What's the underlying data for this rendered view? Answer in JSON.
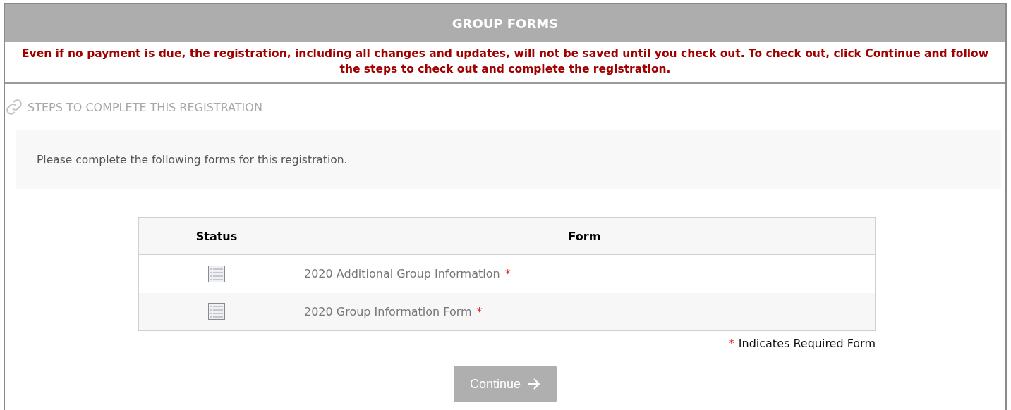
{
  "header": {
    "title": "GROUP FORMS"
  },
  "notice": "Even if no payment is due, the registration, including all changes and updates, will not be saved until you check out. To check out, click Continue and follow the steps to check out and complete the registration.",
  "steps_heading": "STEPS TO COMPLETE THIS REGISTRATION",
  "instructions": "Please complete the following forms for this registration.",
  "table": {
    "columns": [
      "Status",
      "Form"
    ],
    "rows": [
      {
        "form": "2020 Additional Group Information",
        "required_mark": "*"
      },
      {
        "form": "2020 Group Information Form",
        "required_mark": "*"
      }
    ]
  },
  "legend": {
    "mark": "*",
    "text": "Indicates Required Form"
  },
  "continue_button": {
    "label": "Continue",
    "disabled": true
  }
}
